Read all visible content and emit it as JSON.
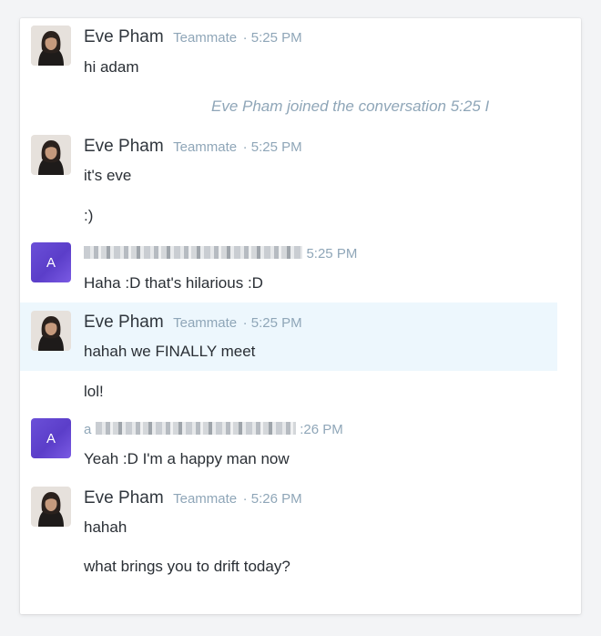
{
  "conversation": {
    "messages": [
      {
        "author": "Eve Pham",
        "role": "Teammate",
        "time": "· 5:25 PM",
        "lines": [
          "hi adam"
        ]
      },
      {
        "system": "Eve Pham joined the conversation 5:25 I"
      },
      {
        "author": "Eve Pham",
        "role": "Teammate",
        "time": "· 5:25 PM",
        "lines": [
          "it's eve",
          ":)"
        ]
      },
      {
        "avatar_letter": "A",
        "time": "5:25 PM",
        "lines": [
          "Haha :D that's hilarious :D"
        ]
      },
      {
        "author": "Eve Pham",
        "role": "Teammate",
        "time": "· 5:25 PM",
        "lines": [
          "hahah we FINALLY meet",
          "lol!"
        ]
      },
      {
        "avatar_letter": "A",
        "time_prefix": "a",
        "time": ":26 PM",
        "lines": [
          "Yeah :D I'm a happy man now"
        ]
      },
      {
        "author": "Eve Pham",
        "role": "Teammate",
        "time": "· 5:26 PM",
        "lines": [
          "hahah",
          "what brings you to drift today?"
        ]
      }
    ]
  },
  "colors": {
    "accent_avatar": "#5b3ec9",
    "highlight_row": "#edf7fd",
    "meta_text": "#8fa6b8"
  }
}
